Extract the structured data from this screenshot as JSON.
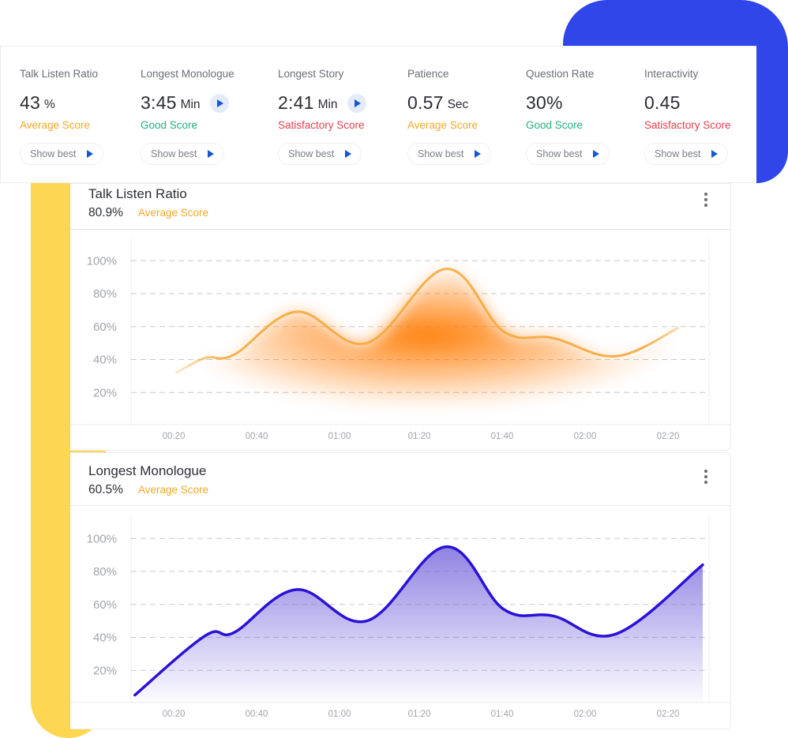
{
  "colors": {
    "accent_blue": "#3046e8",
    "accent_yellow": "#fdd652",
    "play_blue": "#1656d4",
    "score_average": "#f5a623",
    "score_good": "#22b07d",
    "score_satisfactory": "#e53e4b",
    "orange_line": "#f7a93b",
    "orange_fill": "#ff7a00",
    "purple_line": "#2a12d6",
    "purple_fill": "#6a5ad9"
  },
  "metrics": [
    {
      "label": "Talk Listen Ratio",
      "value": "43",
      "unit": "%",
      "score": "Average Score",
      "score_type": "average",
      "has_play": false,
      "button": "Show best"
    },
    {
      "label": "Longest Monologue",
      "value": "3:45",
      "unit": "Min",
      "score": "Good Score",
      "score_type": "good",
      "has_play": true,
      "button": "Show best"
    },
    {
      "label": "Longest Story",
      "value": "2:41",
      "unit": "Min",
      "score": "Satisfactory Score",
      "score_type": "satisfactory",
      "has_play": true,
      "button": "Show best"
    },
    {
      "label": "Patience",
      "value": "0.57",
      "unit": "Sec",
      "score": "Average Score",
      "score_type": "average",
      "has_play": false,
      "button": "Show best"
    },
    {
      "label": "Question Rate",
      "value": "30%",
      "unit": "",
      "score": "Good Score",
      "score_type": "good",
      "has_play": false,
      "button": "Show best"
    },
    {
      "label": "Interactivity",
      "value": "0.45",
      "unit": "",
      "score": "Satisfactory Score",
      "score_type": "satisfactory",
      "has_play": false,
      "button": "Show best"
    }
  ],
  "charts": [
    {
      "title": "Talk Listen Ratio",
      "percent": "80.9%",
      "score": "Average Score",
      "score_type": "average",
      "menu_icon": "kebab-menu-icon"
    },
    {
      "title": "Longest Monologue",
      "percent": "60.5%",
      "score": "Average Score",
      "score_type": "average",
      "menu_icon": "kebab-menu-icon"
    }
  ],
  "chart_data": [
    {
      "type": "area",
      "title": "Talk Listen Ratio",
      "subtitle": "80.9% Average Score",
      "style": "glow",
      "xlabel": "",
      "ylabel": "",
      "x_tick_labels": [
        "00:20",
        "00:40",
        "01:00",
        "01:20",
        "01:40",
        "02:00",
        "02:20"
      ],
      "x_ticks_seconds": [
        20,
        40,
        60,
        80,
        100,
        120,
        140
      ],
      "y_tick_labels": [
        "100%",
        "80%",
        "60%",
        "40%",
        "20%"
      ],
      "y_ticks": [
        100,
        80,
        60,
        40,
        20
      ],
      "xlim_seconds": [
        10,
        150
      ],
      "ylim": [
        0,
        110
      ],
      "grid": true,
      "series": [
        {
          "name": "Talk Listen Ratio",
          "x_seconds": [
            21,
            28,
            35,
            50,
            67,
            86,
            100,
            112,
            127,
            142
          ],
          "values": [
            32,
            41,
            43,
            69,
            50,
            95,
            57,
            53,
            42,
            59
          ]
        }
      ]
    },
    {
      "type": "area",
      "title": "Longest Monologue",
      "subtitle": "60.5% Average Score",
      "style": "gradient",
      "xlabel": "",
      "ylabel": "",
      "x_tick_labels": [
        "00:20",
        "00:40",
        "01:00",
        "01:20",
        "01:40",
        "02:00",
        "02:20"
      ],
      "x_ticks_seconds": [
        20,
        40,
        60,
        80,
        100,
        120,
        140
      ],
      "y_tick_labels": [
        "100%",
        "80%",
        "60%",
        "40%",
        "20%"
      ],
      "y_ticks": [
        100,
        80,
        60,
        40,
        20
      ],
      "xlim_seconds": [
        10,
        150
      ],
      "ylim": [
        0,
        110
      ],
      "grid": true,
      "series": [
        {
          "name": "Longest Monologue",
          "x_seconds": [
            11,
            28,
            35,
            50,
            67,
            86,
            100,
            112,
            127,
            148
          ],
          "values": [
            5,
            41,
            43,
            69,
            50,
            95,
            57,
            53,
            42,
            84
          ]
        }
      ]
    }
  ]
}
